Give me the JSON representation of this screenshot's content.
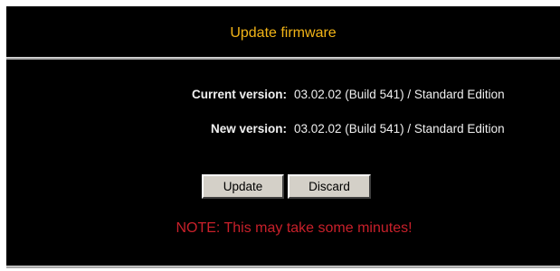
{
  "header": {
    "title": "Update firmware"
  },
  "versions": [
    {
      "label": "Current version:",
      "value": "03.02.02 (Build 541) / Standard Edition"
    },
    {
      "label": "New version:",
      "value": "03.02.02 (Build 541) / Standard Edition"
    }
  ],
  "actions": {
    "update_label": "Update",
    "discard_label": "Discard"
  },
  "note": "NOTE: This may take some minutes!",
  "colors": {
    "background": "#000000",
    "title": "#f2b417",
    "note": "#c8202a",
    "text": "#f0f0f0",
    "rule": "#a9a9a9",
    "button_face": "#d4d0c8"
  }
}
